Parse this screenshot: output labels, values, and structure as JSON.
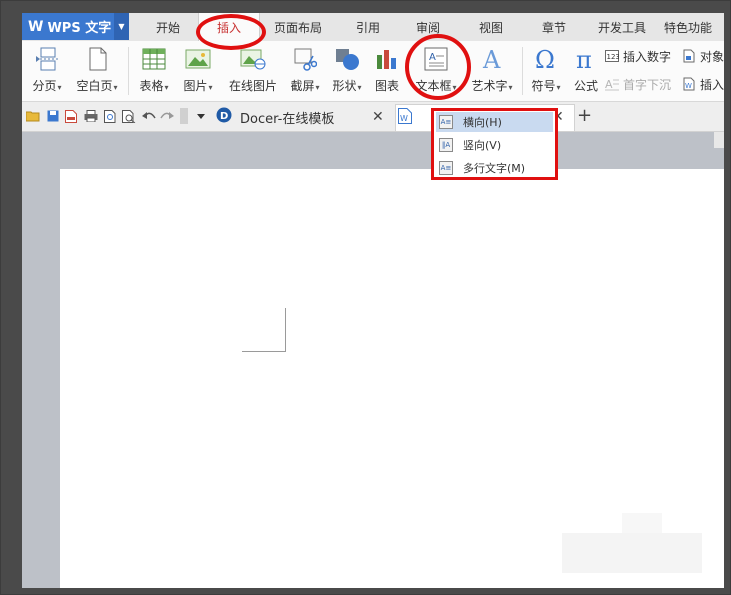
{
  "app": {
    "name": "WPS 文字",
    "logo_glyph": "W"
  },
  "menu_tabs": [
    "开始",
    "插入",
    "页面布局",
    "引用",
    "审阅",
    "视图",
    "章节",
    "开发工具",
    "特色功能"
  ],
  "active_tab": "插入",
  "ribbon": {
    "page_break": "分页",
    "blank_page": "空白页",
    "table": "表格",
    "picture": "图片",
    "online_picture": "在线图片",
    "screenshot": "截屏",
    "shape": "形状",
    "chart": "图表",
    "textbox": "文本框",
    "wordart": "艺术字",
    "symbol": "符号",
    "formula": "公式",
    "insert_number": "插入数字",
    "object": "对象",
    "dropcap": "首字下沉",
    "insert_more": "插入"
  },
  "doc_tabs": [
    {
      "label": "Docer-在线模板"
    }
  ],
  "textbox_menu": [
    {
      "label": "横向(H)",
      "highlighted": true
    },
    {
      "label": "竖向(V)",
      "highlighted": false
    },
    {
      "label": "多行文字(M)",
      "highlighted": false
    }
  ],
  "colors": {
    "accent": "#3b78cf",
    "highlight_ring": "#e01010",
    "active_tab_text": "#c83232"
  }
}
